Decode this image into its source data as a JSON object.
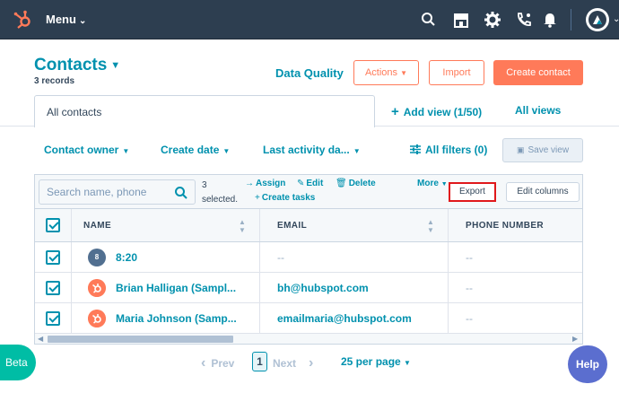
{
  "topnav": {
    "menu_label": "Menu",
    "icons": [
      "hubspot-logo",
      "search-icon",
      "marketplace-icon",
      "settings-icon",
      "calling-icon",
      "notifications-icon",
      "avatar"
    ]
  },
  "header": {
    "title": "Contacts",
    "records": "3 records",
    "data_quality": "Data Quality",
    "actions_label": "Actions",
    "import_label": "Import",
    "create_label": "Create contact"
  },
  "views": {
    "active_tab": "All contacts",
    "add_view": "Add view (1/50)",
    "all_views": "All views"
  },
  "filters": {
    "contact_owner": "Contact owner",
    "create_date": "Create date",
    "last_activity": "Last activity da...",
    "all_filters": "All filters (0)",
    "save_view": "Save view"
  },
  "table": {
    "search_placeholder": "Search name, phone",
    "selected_count": "3",
    "selected_label": "selected.",
    "assign": "Assign",
    "edit": "Edit",
    "delete": "Delete",
    "create_tasks": "Create tasks",
    "more": "More",
    "export": "Export",
    "edit_columns": "Edit columns",
    "columns": [
      "NAME",
      "EMAIL",
      "PHONE NUMBER"
    ],
    "rows": [
      {
        "avatar": "8",
        "name": "8:20",
        "email": "--",
        "phone": "--"
      },
      {
        "avatar": "",
        "name": "Brian Halligan (Sampl...",
        "email": "bh@hubspot.com",
        "phone": "--"
      },
      {
        "avatar": "",
        "name": "Maria Johnson (Samp...",
        "email": "emailmaria@hubspot.com",
        "phone": "--"
      }
    ]
  },
  "pagination": {
    "prev": "Prev",
    "page": "1",
    "next": "Next",
    "per_page": "25 per page"
  },
  "beta_label": "Beta",
  "help_label": "Help",
  "colors": {
    "nav_bg": "#2d3e50",
    "accent": "#ff7a59",
    "link": "#0091ae",
    "export_highlight": "#e0181b"
  }
}
